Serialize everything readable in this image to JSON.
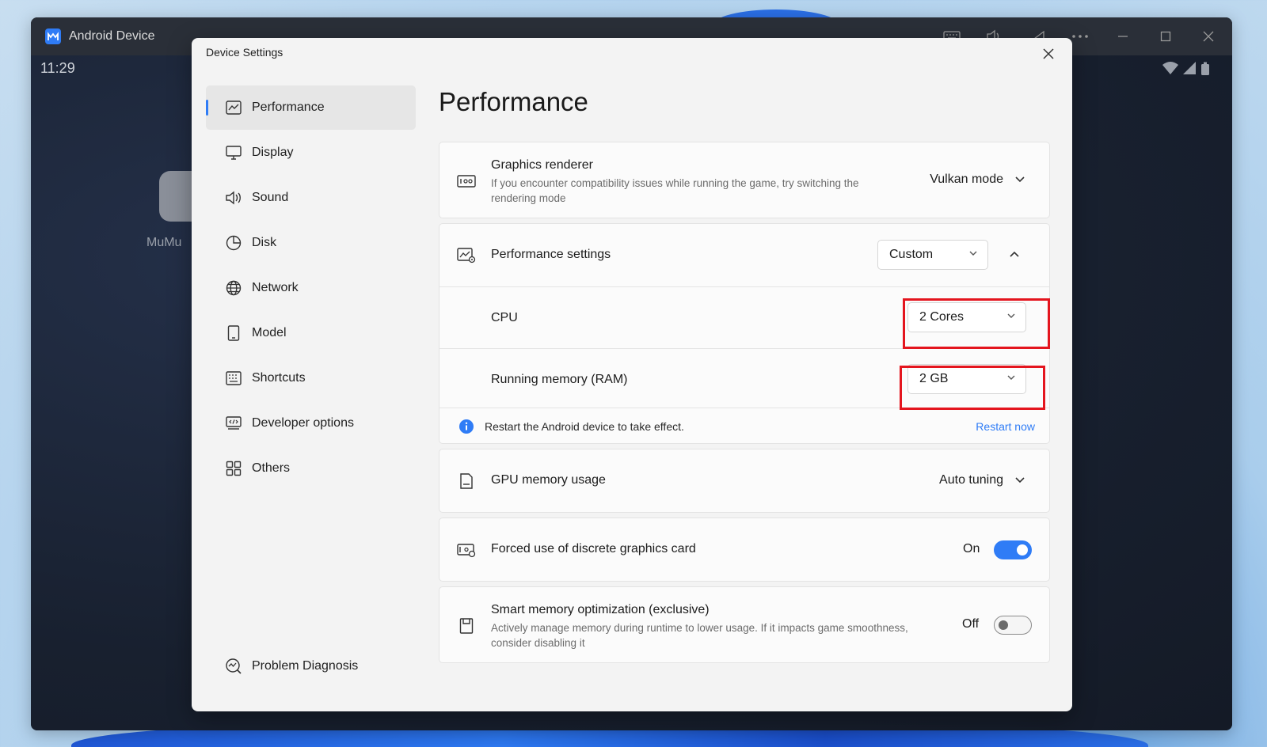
{
  "android_window": {
    "title": "Android Device",
    "time": "11:29",
    "app_label": "MuMu"
  },
  "dialog": {
    "title": "Device Settings"
  },
  "sidebar": {
    "items": [
      {
        "label": "Performance",
        "icon": "performance-icon",
        "active": true
      },
      {
        "label": "Display",
        "icon": "monitor-icon"
      },
      {
        "label": "Sound",
        "icon": "speaker-icon"
      },
      {
        "label": "Disk",
        "icon": "pie-chart-icon"
      },
      {
        "label": "Network",
        "icon": "globe-icon"
      },
      {
        "label": "Model",
        "icon": "phone-icon"
      },
      {
        "label": "Shortcuts",
        "icon": "keyboard-icon"
      },
      {
        "label": "Developer options",
        "icon": "code-icon"
      },
      {
        "label": "Others",
        "icon": "grid-icon"
      }
    ],
    "bottom_item": {
      "label": "Problem Diagnosis",
      "icon": "diagnosis-icon"
    }
  },
  "main": {
    "page_title": "Performance",
    "graphics_renderer": {
      "label": "Graphics renderer",
      "description": "If you encounter compatibility issues while running the game, try switching the rendering mode",
      "value": "Vulkan mode"
    },
    "performance_settings": {
      "label": "Performance settings",
      "value": "Custom",
      "cpu": {
        "label": "CPU",
        "value": "2 Cores"
      },
      "ram": {
        "label": "Running memory (RAM)",
        "value": "2 GB"
      },
      "info": {
        "text": "Restart the Android device to take effect.",
        "link": "Restart now"
      }
    },
    "gpu_memory": {
      "label": "GPU memory usage",
      "value": "Auto tuning"
    },
    "discrete_gpu": {
      "label": "Forced use of discrete graphics card",
      "state": "On"
    },
    "smart_memory": {
      "label": "Smart memory optimization (exclusive)",
      "description": "Actively manage memory during runtime to lower usage. If it impacts game smoothness, consider disabling it",
      "state": "Off"
    }
  },
  "colors": {
    "accent": "#2f7cf6",
    "highlight_box": "#e4151e"
  }
}
